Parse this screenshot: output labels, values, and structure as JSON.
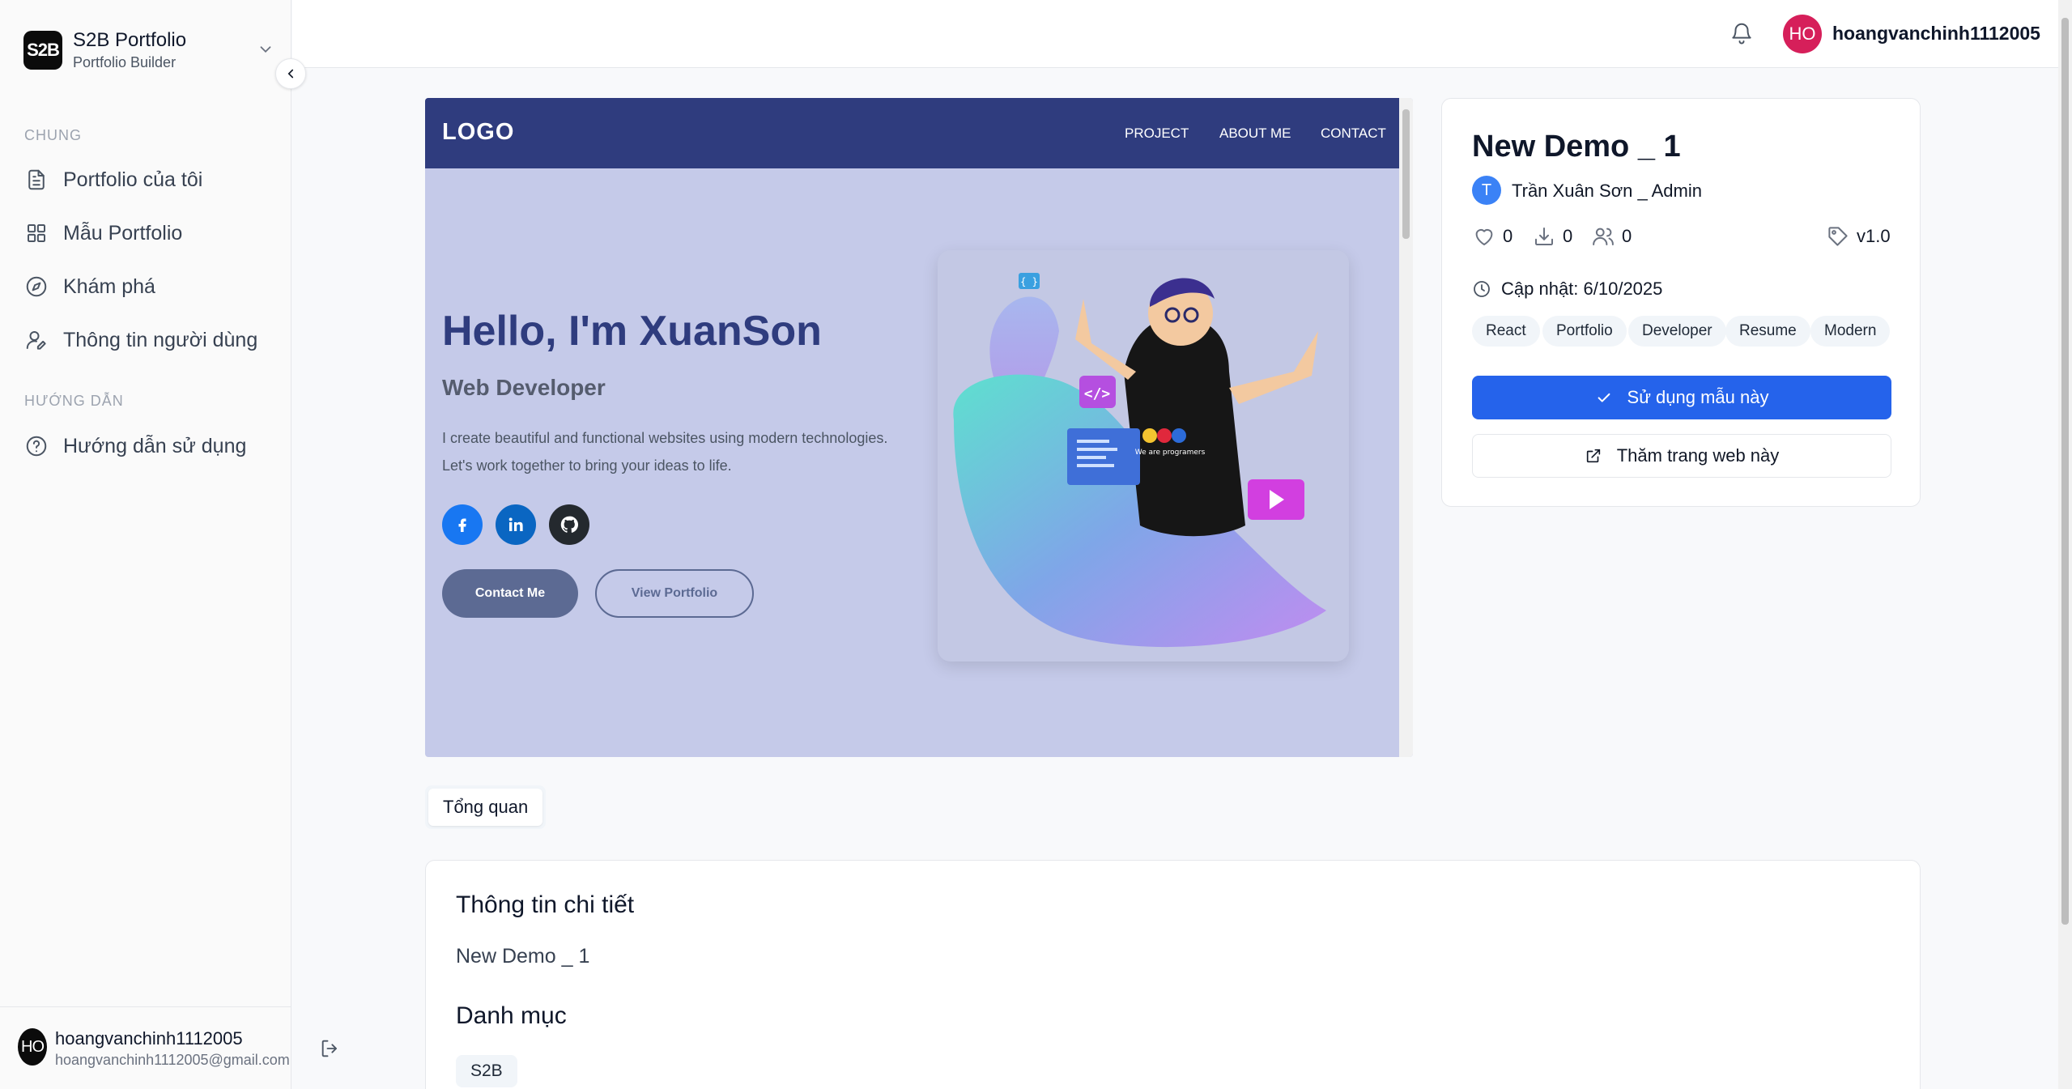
{
  "brand": {
    "logo": "S2B",
    "name": "S2B Portfolio",
    "subtitle": "Portfolio Builder"
  },
  "sidebar": {
    "sections": [
      {
        "label": "CHUNG"
      },
      {
        "label": "HƯỚNG DẪN"
      }
    ],
    "items": [
      {
        "label": "Portfolio của tôi",
        "icon": "file-text-icon"
      },
      {
        "label": "Mẫu Portfolio",
        "icon": "grid-icon"
      },
      {
        "label": "Khám phá",
        "icon": "compass-icon"
      },
      {
        "label": "Thông tin người dùng",
        "icon": "user-edit-icon"
      },
      {
        "label": "Hướng dẫn sử dụng",
        "icon": "help-circle-icon"
      }
    ],
    "footer": {
      "avatar": "HO",
      "name": "hoangvanchinh1112005",
      "email": "hoangvanchinh1112005@gmail.com"
    }
  },
  "header": {
    "avatar": "HO",
    "username": "hoangvanchinh1112005",
    "avatar_color": "#d61f5a"
  },
  "preview": {
    "logo": "LOGO",
    "nav": [
      "PROJECT",
      "ABOUT ME",
      "CONTACT"
    ],
    "title": "Hello, I'm XuanSon",
    "role": "Web Developer",
    "description": "I create beautiful and functional websites using modern technologies. Let's work together to bring your ideas to life.",
    "social": [
      "facebook-icon",
      "linkedin-icon",
      "github-icon"
    ],
    "primary_button": "Contact Me",
    "secondary_button": "View Portfolio",
    "art_text": "We are programers",
    "colors": {
      "nav": "#2f3c7e",
      "background": "#c5cae9",
      "title": "#2f3c7e"
    }
  },
  "card": {
    "title": "New Demo _ 1",
    "author_initial": "T",
    "author": "Trần Xuân Sơn _ Admin",
    "likes": "0",
    "downloads": "0",
    "users": "0",
    "version": "v1.0",
    "updated": "Cập nhật: 6/10/2025",
    "tags": [
      "React",
      "Portfolio",
      "Developer",
      "Resume",
      "Modern"
    ],
    "use_button": "Sử dụng mẫu này",
    "visit_button": "Thăm trang web này",
    "accent": "#2563eb"
  },
  "tabs": {
    "overview": "Tổng quan"
  },
  "detail": {
    "heading": "Thông tin chi tiết",
    "description": "New Demo _ 1",
    "category_heading": "Danh mục",
    "category": "S2B"
  }
}
